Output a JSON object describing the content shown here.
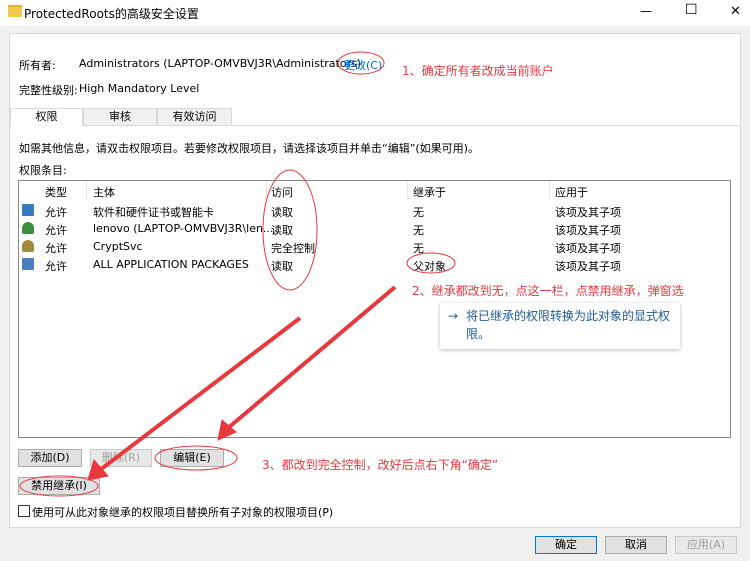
{
  "window": {
    "title": "ProtectedRoots的高级安全设置",
    "minimize": "—",
    "maximize": "☐",
    "close": "✕"
  },
  "owner": {
    "label": "所有者:",
    "value": "Administrators (LAPTOP-OMVBVJ3R\\Administrators)",
    "change_link": "更改(C)"
  },
  "integrity": {
    "label": "完整性级别:",
    "value": "High Mandatory Level"
  },
  "tabs": [
    {
      "label": "权限"
    },
    {
      "label": "审核"
    },
    {
      "label": "有效访问"
    }
  ],
  "info_text": "如需其他信息，请双击权限项目。若要修改权限项目，请选择该项目并单击“编辑”(如果可用)。",
  "entries_label": "权限条目:",
  "columns": [
    "类型",
    "主体",
    "访问",
    "继承于",
    "应用于"
  ],
  "rows": [
    {
      "icon": "certificate-group-icon",
      "type": "允许",
      "principal": "软件和硬件证书或智能卡",
      "access": "读取",
      "inherited": "无",
      "applies": "该项及其子项"
    },
    {
      "icon": "user-icon",
      "type": "允许",
      "principal": "lenovo (LAPTOP-OMVBVJ3R\\len...",
      "access": "读取",
      "inherited": "无",
      "applies": "该项及其子项"
    },
    {
      "icon": "users-icon",
      "type": "允许",
      "principal": "CryptSvc",
      "access": "完全控制",
      "inherited": "无",
      "applies": "该项及其子项"
    },
    {
      "icon": "app-packages-icon",
      "type": "允许",
      "principal": "ALL APPLICATION PACKAGES",
      "access": "读取",
      "inherited": "父对象",
      "applies": "该项及其子项"
    }
  ],
  "buttons": {
    "add": "添加(D)",
    "remove": "删除(R)",
    "edit": "编辑(E)",
    "disable_inheritance": "禁用继承(I)",
    "ok": "确定",
    "cancel": "取消",
    "apply": "应用(A)"
  },
  "checkbox": {
    "label": "使用可从此对象继承的权限项目替换所有子对象的权限项目(P)",
    "checked": false
  },
  "tooltip": {
    "arrow": "→",
    "text": "将已继承的权限转换为此对象的显式权限。"
  },
  "annotations": {
    "step1": "1、确定所有者改成当前账户",
    "step2": "2、继承都改到无，点这一栏，点禁用继承，弹窗选",
    "step3": "3、都改到完全控制，改好后点右下角“确定”",
    "color": "#e8383d"
  }
}
